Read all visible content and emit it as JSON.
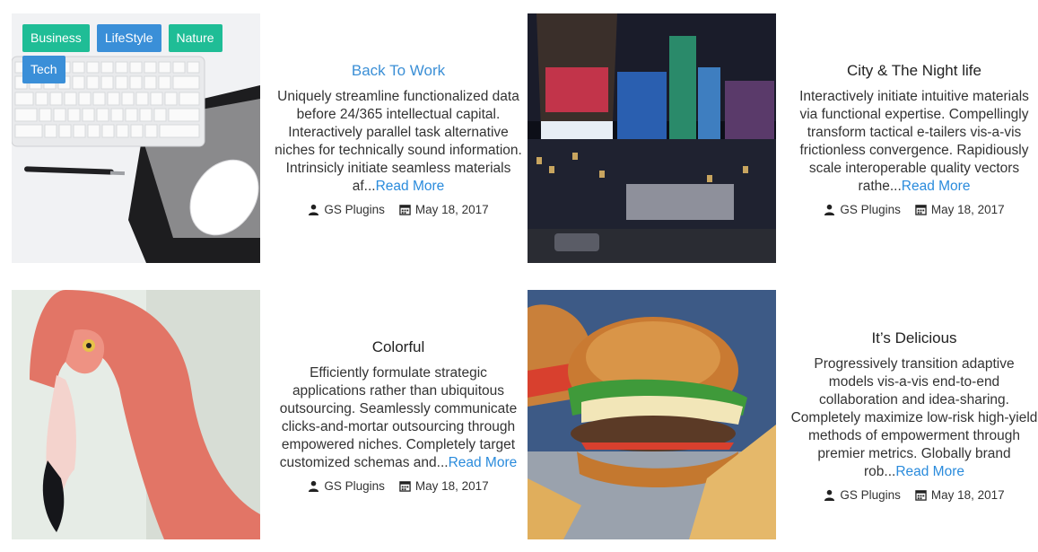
{
  "tags": [
    {
      "label": "Business",
      "color": "#1fbd96"
    },
    {
      "label": "LifeStyle",
      "color": "#3a8fd8"
    },
    {
      "label": "Nature",
      "color": "#1fbd96"
    },
    {
      "label": "Tech",
      "color": "#3a8fd8"
    }
  ],
  "posts": [
    {
      "title": "Back To Work",
      "excerpt": "Uniquely streamline functionalized data before 24/365 intellectual capital. Interactively parallel task alternative niches for technically sound information. Intrinsicly initiate seamless materials af...",
      "read_more": "Read More",
      "author": "GS Plugins",
      "date": "May 18, 2017",
      "image_icon": "keyboard-mouse-photo"
    },
    {
      "title": "City & The Night life",
      "excerpt": "Interactively initiate intuitive materials via functional expertise. Compellingly transform tactical e-tailers vis-a-vis frictionless convergence. Rapidiously scale interoperable quality vectors rathe...",
      "read_more": "Read More",
      "author": "GS Plugins",
      "date": "May 18, 2017",
      "image_icon": "city-night-photo"
    },
    {
      "title": "Colorful",
      "excerpt": "Efficiently formulate strategic applications rather than ubiquitous outsourcing. Seamlessly communicate clicks-and-mortar outsourcing through empowered niches. Completely target customized schemas and...",
      "read_more": "Read More",
      "author": "GS Plugins",
      "date": "May 18, 2017",
      "image_icon": "flamingo-photo"
    },
    {
      "title": "It’s Delicious",
      "excerpt": "Progressively transition adaptive models vis-a-vis end-to-end collaboration and idea-sharing. Completely maximize low-risk high-yield methods of empowerment through premier metrics. Globally brand rob...",
      "read_more": "Read More",
      "author": "GS Plugins",
      "date": "May 18, 2017",
      "image_icon": "burger-photo"
    }
  ],
  "colors": {
    "accent_link": "#2a8bdc",
    "tag_green": "#1fbd96",
    "tag_blue": "#3a8fd8"
  }
}
